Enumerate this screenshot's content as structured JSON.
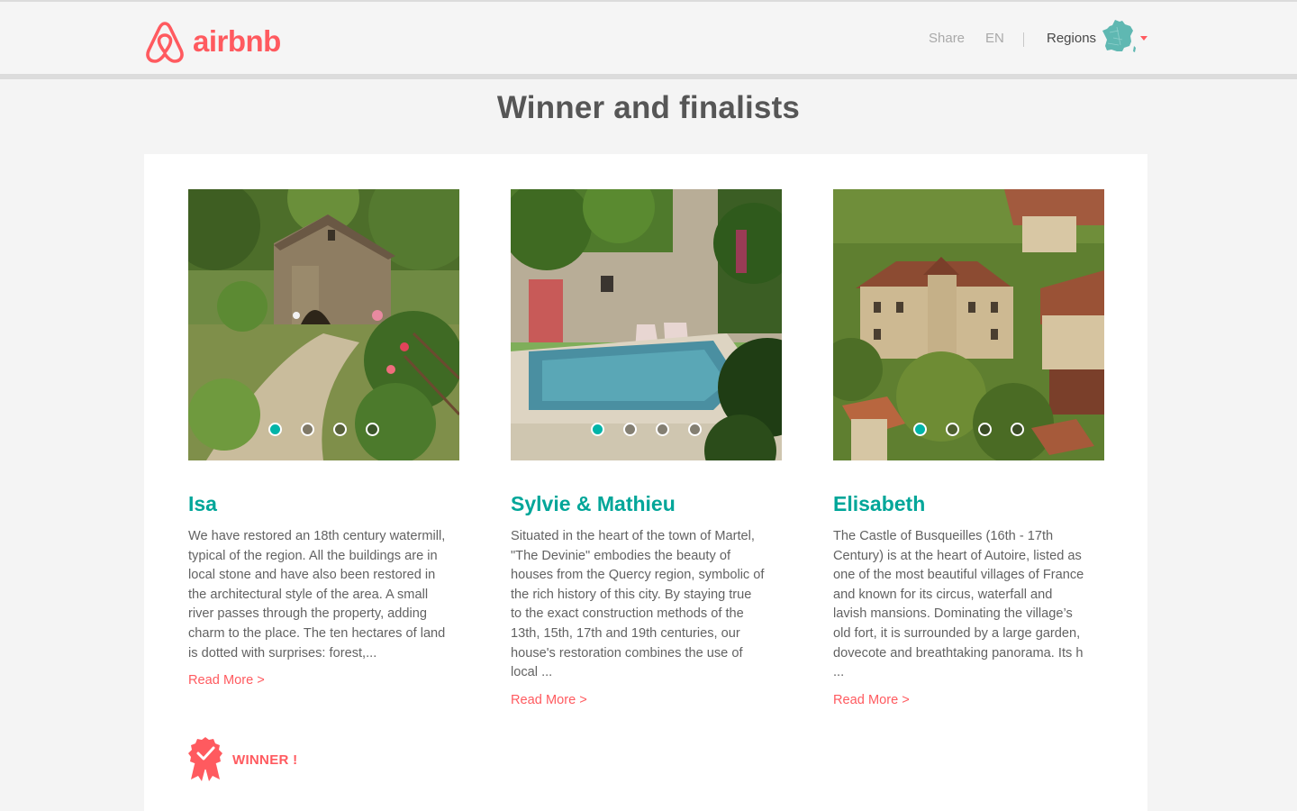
{
  "header": {
    "logo_text": "airbnb",
    "share_label": "Share",
    "lang_label": "EN",
    "regions_label": "Regions"
  },
  "colors": {
    "brand": "#ff5a5f",
    "accent": "#00a699",
    "map": "#5fb8b2"
  },
  "page_title": "Winner and finalists",
  "cards": [
    {
      "name": "Isa",
      "description": "We have restored an 18th century watermill,\ntypical of the region. All the buildings are in\nlocal stone and have also been restored in\nthe architectural style of the area. A small\nriver passes through the property, adding\ncharm to the place. The ten hectares of land\nis dotted with surprises: forest,...",
      "read_more": "Read More >",
      "image_icon": "watermill-photo",
      "carousel_active": 1,
      "carousel_count": 4
    },
    {
      "name": "Sylvie & Mathieu",
      "description": "Situated in the heart of the town of Martel,\n\"The Devinie\" embodies the beauty of\nhouses from the Quercy region, symbolic of\nthe rich history of this city. By staying true\nto the exact construction methods of the\n13th, 15th, 17th and 19th centuries, our\nhouse's restoration combines the use of\nlocal ...",
      "read_more": "Read More >",
      "image_icon": "stone-house-pool-photo",
      "carousel_active": 1,
      "carousel_count": 4
    },
    {
      "name": "Elisabeth",
      "description": "The Castle of Busqueilles (16th - 17th\nCentury) is at the heart of Autoire, listed as\none of the most beautiful villages of France\nand known for its circus, waterfall and\nlavish mansions. Dominating the village’s\nold fort, it is surrounded by a large garden,\ndovecote and breathtaking panorama. Its h\n...",
      "read_more": "Read More >",
      "image_icon": "castle-village-photo",
      "carousel_active": 1,
      "carousel_count": 4
    }
  ],
  "winner": {
    "label": "WINNER !",
    "icon": "award-ribbon-icon"
  }
}
